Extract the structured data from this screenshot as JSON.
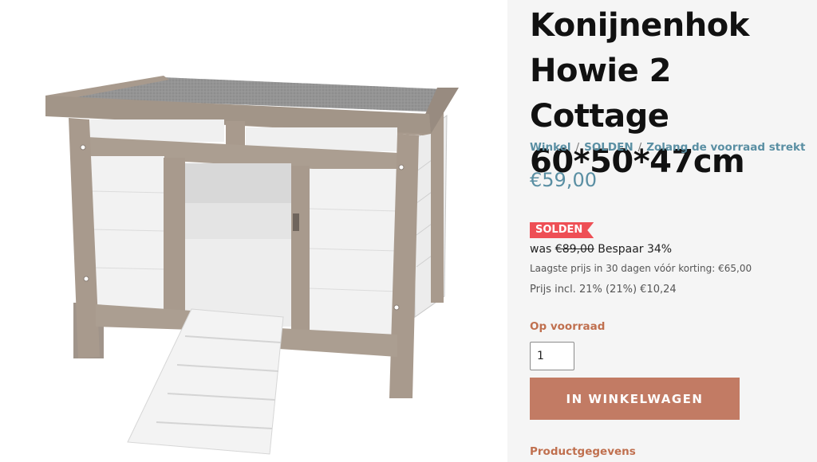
{
  "product": {
    "title": "Konijnenhok Howie 2 Cottage 60*50*47cm",
    "image_alt": "Konijnenhok Howie 2 Cottage"
  },
  "breadcrumb": {
    "items": [
      "Winkel",
      "SOLDEN",
      "Zolang de voorraad strekt"
    ],
    "separator": "/"
  },
  "pricing": {
    "price": "€59,00",
    "sale_badge": "SOLDEN",
    "was_label": "was",
    "was_price": "€89,00",
    "savings": "Bespaar 34%",
    "lowest_price_note": "Laagste prijs in 30 dagen vóór korting: €65,00",
    "vat_note": "Prijs incl. 21% (21%) €10,24"
  },
  "stock": {
    "status": "Op voorraad"
  },
  "quantity": {
    "value": "1"
  },
  "cart": {
    "button_label": "IN WINKELWAGEN"
  },
  "details": {
    "heading": "Productgegevens"
  },
  "colors": {
    "accent_blue": "#5a8fa3",
    "accent_terracotta": "#c27b64",
    "sale_red": "#ee4f55"
  }
}
